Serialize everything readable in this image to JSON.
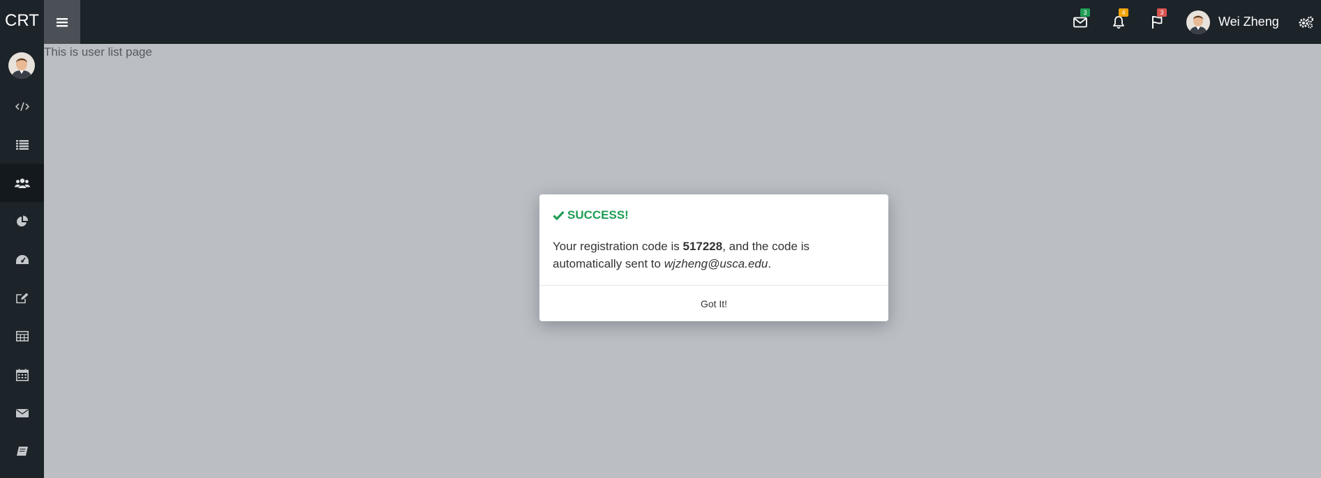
{
  "topbar": {
    "brand": "CRT",
    "messages_badge": "3",
    "notifications_badge": "4",
    "flags_badge": "3",
    "user_name": "Wei Zheng",
    "colors": {
      "bg": "#1c2329",
      "messages_badge": "#1f9d55",
      "notifications_badge": "#f0a30a",
      "flags_badge": "#d9534f"
    }
  },
  "sidebar": {
    "icons": [
      "code-icon",
      "list-icon",
      "users-icon",
      "pie-chart-icon",
      "dashboard-icon",
      "edit-icon",
      "table-icon",
      "calendar-icon",
      "envelope-icon",
      "book-icon"
    ],
    "active": "users-icon"
  },
  "content": {
    "text": "This is user list page"
  },
  "modal": {
    "title": "SUCCESS!",
    "body_prefix": "Your registration code is ",
    "code": "517228",
    "body_middle": ", and the code is automatically sent to ",
    "email": "wjzheng@usca.edu",
    "body_suffix": ".",
    "button": "Got It!",
    "accent": "#1f9d55"
  }
}
